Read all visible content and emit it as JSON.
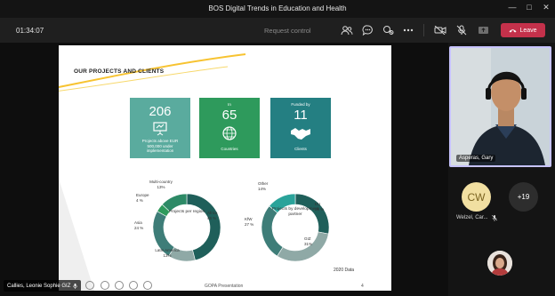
{
  "window": {
    "title": "BOS Digital Trends in Education and Health"
  },
  "toolbar": {
    "timer": "01:34:07",
    "request_control": "Request control",
    "leave_label": "Leave"
  },
  "slide": {
    "title": "OUR PROJECTS AND CLIENTS",
    "tiles": [
      {
        "top_text": "",
        "value": "206",
        "caption": "Projects above EUR 500,000 under implementation",
        "icon": "presentation-board-icon",
        "color": "#5aab9e"
      },
      {
        "top_text": "In",
        "value": "65",
        "caption": "Countries",
        "icon": "globe-icon",
        "color": "#2e9a5c"
      },
      {
        "top_text": "Funded by",
        "value": "11",
        "caption": "Clients",
        "icon": "handshake-icon",
        "color": "#247f82"
      }
    ],
    "donut_region": {
      "center_label": "Projects per region",
      "segments": [
        {
          "label": "Africa",
          "value": "46 %",
          "pct": 46,
          "color": "#1f5f5a"
        },
        {
          "label": "Latin America",
          "value": "13%",
          "pct": 13,
          "color": "#8fa9a6"
        },
        {
          "label": "Asia",
          "value": "24 %",
          "pct": 24,
          "color": "#3e7d78"
        },
        {
          "label": "Europe",
          "value": "4 %",
          "pct": 4,
          "color": "#2e9a5c"
        },
        {
          "label": "Multi-country",
          "value": "13%",
          "pct": 13,
          "color": "#2d8a66"
        }
      ]
    },
    "donut_partner": {
      "center_label": "Projects by development partner",
      "segments": [
        {
          "label": "EU",
          "value": "28 %",
          "pct": 28,
          "color": "#1f5f5a"
        },
        {
          "label": "GIZ",
          "value": "31%",
          "pct": 31,
          "color": "#8fa9a6"
        },
        {
          "label": "KfW",
          "value": "27 %",
          "pct": 27,
          "color": "#3e7d78"
        },
        {
          "label": "Other",
          "value": "14%",
          "pct": 14,
          "color": "#2aa39a"
        }
      ]
    },
    "data_note": "2020 Data",
    "footer_text": "GOPA Presentation",
    "page_number": "4"
  },
  "participants": {
    "main_video_name": "Asperas, Gary",
    "cw": {
      "initials": "CW",
      "name": "Welzel, Car...",
      "color": "#f1dfa1"
    },
    "more_count": "+19"
  },
  "presenter": {
    "name": "Callies, Leonie Sophie GIZ"
  }
}
